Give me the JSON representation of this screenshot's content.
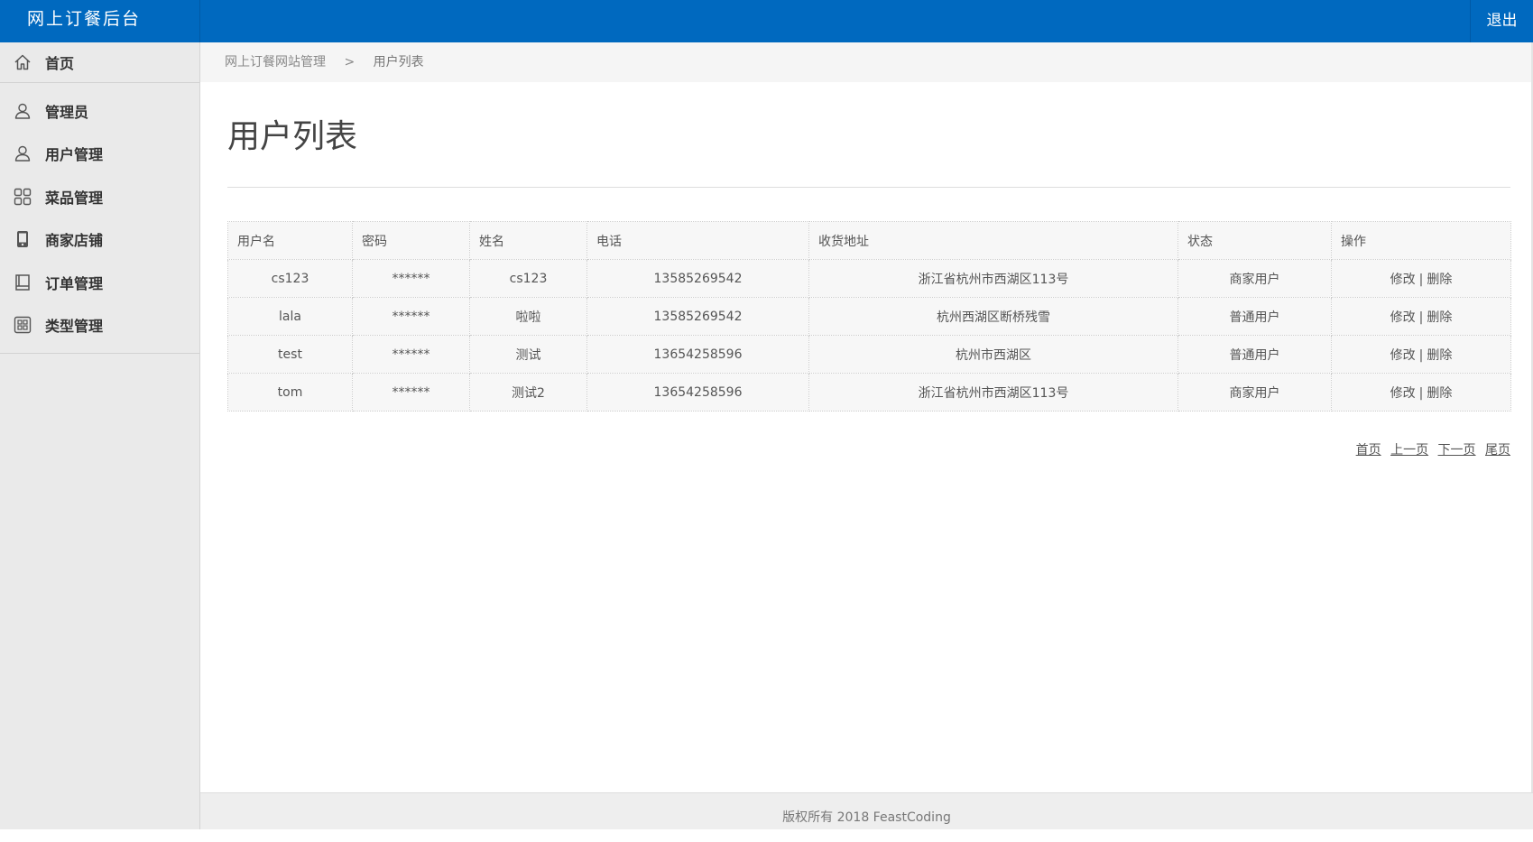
{
  "header": {
    "brand": "网上订餐后台",
    "logout": "退出"
  },
  "sidebar": {
    "home": {
      "label": "首页",
      "icon": "home-icon"
    },
    "items": [
      {
        "label": "管理员",
        "icon": "user-icon"
      },
      {
        "label": "用户管理",
        "icon": "user-icon"
      },
      {
        "label": "菜品管理",
        "icon": "grid-icon"
      },
      {
        "label": "商家店铺",
        "icon": "phone-icon"
      },
      {
        "label": "订单管理",
        "icon": "book-icon"
      },
      {
        "label": "类型管理",
        "icon": "grid-square-icon"
      }
    ]
  },
  "breadcrumb": {
    "root": "网上订餐网站管理",
    "separator": ">",
    "current": "用户列表"
  },
  "main": {
    "title": "用户列表"
  },
  "table": {
    "headers": [
      "用户名",
      "密码",
      "姓名",
      "电话",
      "收货地址",
      "状态",
      "操作"
    ],
    "rows": [
      {
        "username": "cs123",
        "password": "******",
        "name": "cs123",
        "phone": "13585269542",
        "address": "浙江省杭州市西湖区113号",
        "status": "商家用户",
        "edit": "修改",
        "delete": "删除"
      },
      {
        "username": "lala",
        "password": "******",
        "name": "啦啦",
        "phone": "13585269542",
        "address": "杭州西湖区断桥残雪",
        "status": "普通用户",
        "edit": "修改",
        "delete": "删除"
      },
      {
        "username": "test",
        "password": "******",
        "name": "测试",
        "phone": "13654258596",
        "address": "杭州市西湖区",
        "status": "普通用户",
        "edit": "修改",
        "delete": "删除"
      },
      {
        "username": "tom",
        "password": "******",
        "name": "测试2",
        "phone": "13654258596",
        "address": "浙江省杭州市西湖区113号",
        "status": "商家用户",
        "edit": "修改",
        "delete": "删除"
      }
    ],
    "op_separator": "|"
  },
  "pagination": {
    "first": "首页",
    "prev": "上一页",
    "next": "下一页",
    "last": "尾页"
  },
  "footer": {
    "text": "版权所有 2018 FeastCoding"
  },
  "colors": {
    "topbar": "#0069bf",
    "sidebar_bg": "#eaeaea"
  }
}
